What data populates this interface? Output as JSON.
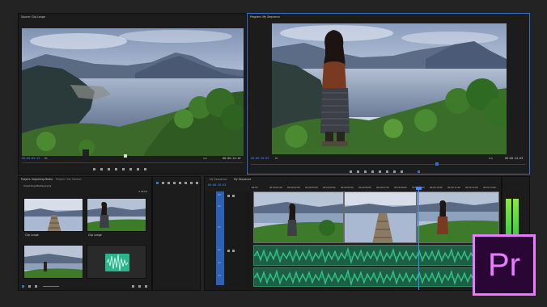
{
  "source_monitor": {
    "tab_label": "Source: Clip Longe",
    "timecode_left": "00:00:09:15",
    "timecode_right": "00:00:14:16",
    "fit_label": "Fit",
    "fraction_label": "1/2"
  },
  "program_monitor": {
    "tab_label": "Program: My Sequence",
    "timecode_left": "00:00:10:03",
    "timecode_right": "00:00:14:03",
    "fit_label": "Fit",
    "fraction_label": "Full"
  },
  "project_panel": {
    "tab_label": "Project: Importing Media",
    "tab2_label": "Project: Get Started",
    "path_label": "Importing Media.prproj",
    "count_label": "4 items",
    "items": [
      {
        "label": "Clip Longe"
      },
      {
        "label": "Clip Longe"
      },
      {
        "label": ""
      },
      {
        "label": ""
      }
    ]
  },
  "timeline": {
    "tab_label": "My Sequence",
    "tab2_label": "My Sequence",
    "timecode": "00:00:10:03",
    "tracks": [
      "V3",
      "V2",
      "V1",
      "A1",
      "A2",
      "A3"
    ],
    "ruler_ticks": [
      "00:00",
      "00:00:01:00",
      "00:00:02:00",
      "00:00:03:00",
      "00:00:04:00",
      "00:00:05:00",
      "00:00:06:00",
      "00:00:07:00",
      "00:00:08:00",
      "00:00:09:00",
      "00:00:10:00",
      "00:00:11:00",
      "00:00:12:00",
      "00:00:13:00"
    ]
  },
  "meters": {
    "level_left": 0.85,
    "level_right": 0.85
  },
  "logo": {
    "text": "Pr",
    "bg": "#2a0634",
    "border": "#e77cff",
    "color": "#e77cff"
  },
  "colors": {
    "accent": "#2f6fd6",
    "audio_wave": "#22a06b",
    "audio_bg": "#1d5f44"
  }
}
